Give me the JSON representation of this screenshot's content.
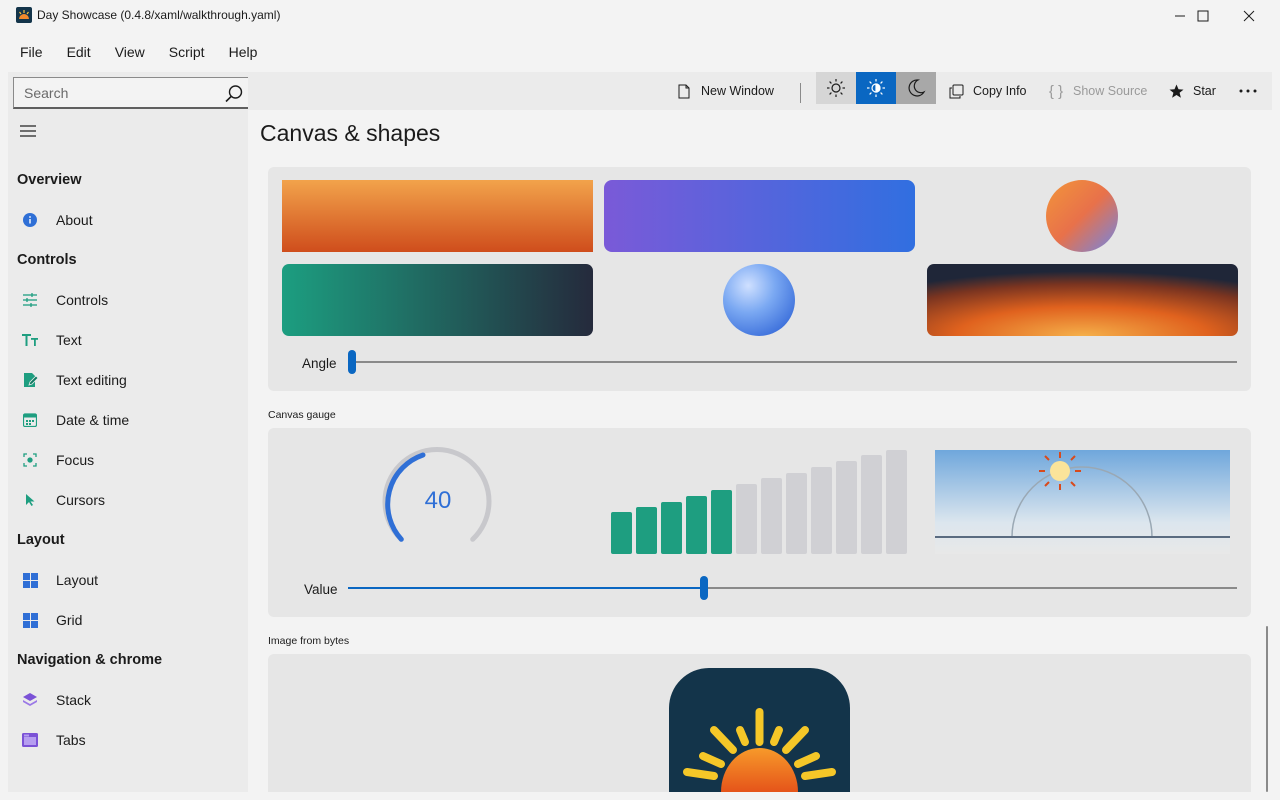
{
  "window": {
    "title": "Day Showcase (0.4.8/xaml/walkthrough.yaml)"
  },
  "menu": [
    "File",
    "Edit",
    "View",
    "Script",
    "Help"
  ],
  "search": {
    "placeholder": "Search",
    "value": ""
  },
  "sidebar": {
    "groups": [
      {
        "header": "Overview",
        "items": [
          {
            "label": "About",
            "icon": "info-icon"
          }
        ]
      },
      {
        "header": "Controls",
        "items": [
          {
            "label": "Controls",
            "icon": "sliders-icon"
          },
          {
            "label": "Text",
            "icon": "text-size-icon"
          },
          {
            "label": "Text editing",
            "icon": "edit-document-icon"
          },
          {
            "label": "Date & time",
            "icon": "calendar-icon"
          },
          {
            "label": "Focus",
            "icon": "focus-icon"
          },
          {
            "label": "Cursors",
            "icon": "cursor-icon"
          }
        ]
      },
      {
        "header": "Layout",
        "items": [
          {
            "label": "Layout",
            "icon": "layout-icon"
          },
          {
            "label": "Grid",
            "icon": "grid-icon"
          }
        ]
      },
      {
        "header": "Navigation & chrome",
        "items": [
          {
            "label": "Stack",
            "icon": "stack-icon"
          },
          {
            "label": "Tabs",
            "icon": "tabs-icon"
          }
        ]
      }
    ]
  },
  "toolbar": {
    "new_window": "New Window",
    "copy_info": "Copy Info",
    "show_source": "Show Source",
    "star": "Star",
    "theme_selected": "high-contrast"
  },
  "page": {
    "title": "Canvas & shapes",
    "shapes_card": {
      "slider_label": "Angle",
      "angle_value": 0
    },
    "gauge_section": {
      "label": "Canvas gauge",
      "gauge_value": "40",
      "slider_label": "Value",
      "value_fraction": 0.4,
      "bars_total": 12,
      "bars_filled": 5
    },
    "image_section": {
      "label": "Image from bytes"
    }
  },
  "colors": {
    "accent": "#0a67c2",
    "teal": "#1e9e80",
    "gauge_blue": "#2f6fd6"
  }
}
